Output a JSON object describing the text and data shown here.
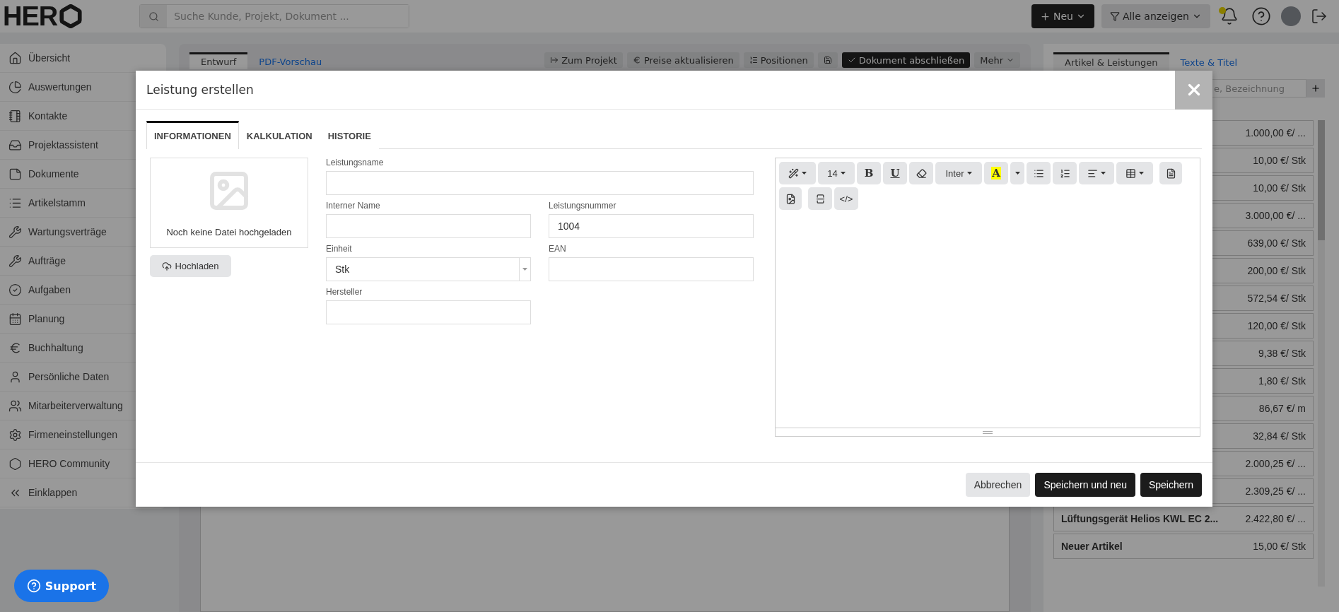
{
  "header": {
    "logo": "HER",
    "search": {
      "placeholder": "Suche Kunde, Projekt, Dokument ..."
    },
    "new_button": "Neu",
    "filter_button": "Alle anzeigen"
  },
  "sidebar": {
    "items": [
      {
        "label": "Übersicht"
      },
      {
        "label": "Auswertungen"
      },
      {
        "label": "Kontakte"
      },
      {
        "label": "Projektassistent"
      },
      {
        "label": "Dokumente"
      },
      {
        "label": "Artikelstamm"
      },
      {
        "label": "Wartungsverträge"
      },
      {
        "label": "Aufträge"
      },
      {
        "label": "Aufgaben"
      },
      {
        "label": "Planung"
      },
      {
        "label": "Buchhaltung"
      },
      {
        "label": "Persönliche Daten"
      },
      {
        "label": "Mitarbeiterverwaltung"
      },
      {
        "label": "Firmeneinstellungen"
      },
      {
        "label": "HERO Community"
      },
      {
        "label": "Einklappen"
      }
    ],
    "support_button": "Support"
  },
  "document": {
    "tabs": [
      {
        "label": "Entwurf",
        "selected": true
      },
      {
        "label": "PDF-Vorschau",
        "selected": false
      }
    ],
    "toolbar": [
      {
        "kind": "project",
        "label": "Zum Projekt"
      },
      {
        "kind": "prices",
        "label": "Preise aktualisieren"
      },
      {
        "kind": "positions",
        "label": "Positionen"
      },
      {
        "kind": "save"
      },
      {
        "kind": "finish",
        "label": "Dokument abschließen"
      },
      {
        "kind": "more",
        "label": "Mehr"
      }
    ]
  },
  "articles_panel": {
    "tabs": [
      {
        "label": "Artikel & Leistungen",
        "selected": true
      },
      {
        "label": "Texte & Titel",
        "selected": false
      }
    ],
    "search": {
      "placeholder": "e, Bezeichnung"
    },
    "rows": [
      {
        "price": "1.000,00 €/ ..."
      },
      {
        "price": "10,00 €/ Stk"
      },
      {
        "price": "10,00 €/ Stk"
      },
      {
        "price": "3.000,00 €/ ..."
      },
      {
        "price": "639,00 €/ Stk"
      },
      {
        "price": "200,00 €/ Stk"
      },
      {
        "price": "572,54 €/ Stk"
      },
      {
        "price": "120,00 €/ Stk"
      },
      {
        "price": "9,38 €/ Stk"
      },
      {
        "price": "1,80 €/ Stk"
      },
      {
        "price": "86,67 €/ m"
      },
      {
        "price": "32,84 €/ Stk"
      },
      {
        "price": "2.000,25 €/ ..."
      },
      {
        "price": "2.309,25 €/ ..."
      },
      {
        "name": "Lüftungsgerät Helios KWL EC 2...",
        "price": "2.422,80 €/ ..."
      },
      {
        "name": "Neuer Artikel",
        "price": "15,00 €/ Stk"
      }
    ]
  },
  "dialog": {
    "title": "Leistung erstellen",
    "tabs": [
      {
        "label": "INFORMATIONEN",
        "selected": true
      },
      {
        "label": "KALKULATION",
        "selected": false
      },
      {
        "label": "HISTORIE",
        "selected": false
      }
    ],
    "image": {
      "caption": "Noch keine Datei hochgeladen",
      "upload_button": "Hochladen"
    },
    "fields": {
      "name": {
        "label": "Leistungsname"
      },
      "internal_name": {
        "label": "Interner Name"
      },
      "number": {
        "label": "Leistungsnummer",
        "value": "1004"
      },
      "unit": {
        "label": "Einheit",
        "value": "Stk"
      },
      "ean": {
        "label": "EAN"
      },
      "manufacturer": {
        "label": "Hersteller"
      }
    },
    "editor_toolbar": [
      [
        {
          "kind": "magic"
        },
        {
          "kind": "size",
          "label": "14"
        },
        {
          "kind": "bold",
          "label": "B"
        },
        {
          "kind": "underline",
          "label": "U"
        },
        {
          "kind": "eraser"
        },
        {
          "kind": "font",
          "label": "Inter"
        },
        {
          "kind": "color",
          "label": "A"
        },
        {
          "kind": "caret"
        },
        {
          "kind": "bullets"
        },
        {
          "kind": "numbers"
        },
        {
          "kind": "align"
        },
        {
          "kind": "table"
        },
        {
          "kind": "document"
        }
      ],
      [
        {
          "kind": "image"
        },
        {
          "kind": "pagebreak"
        },
        {
          "kind": "code",
          "label": "</>"
        }
      ]
    ],
    "buttons": [
      {
        "kind": "secondary",
        "label": "Abbrechen"
      },
      {
        "kind": "primary",
        "label": "Speichern und neu"
      },
      {
        "kind": "primary",
        "label": "Speichern"
      }
    ]
  }
}
